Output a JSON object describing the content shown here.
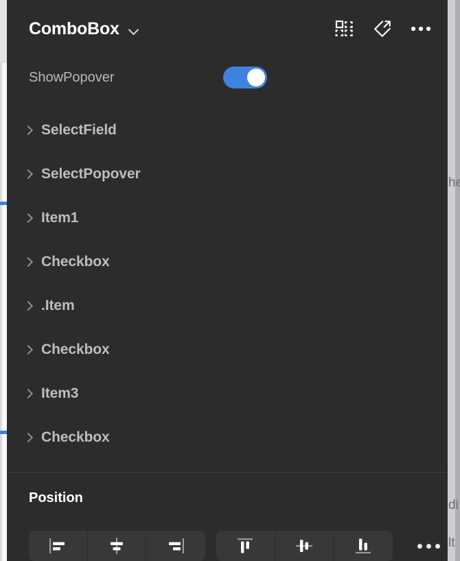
{
  "colors": {
    "panel_bg": "#2c2c2c",
    "canvas_bg": "#c9c9cd",
    "accent_blue": "#3f82e0",
    "group_bg": "#383838",
    "text_primary": "#ffffff",
    "text_secondary": "#bdbdbd"
  },
  "header": {
    "title": "ComboBox",
    "dropdown_icon": "chevron-down-icon",
    "actions": [
      {
        "name": "component-grid-icon",
        "label": "Components"
      },
      {
        "name": "detach-instance-icon",
        "label": "Detach instance"
      },
      {
        "name": "more-options-icon",
        "label": "More options"
      }
    ]
  },
  "properties": [
    {
      "label": "ShowPopover",
      "type": "toggle",
      "value": "on"
    }
  ],
  "tree": {
    "items": [
      {
        "label": "SelectField",
        "expanded": false
      },
      {
        "label": "SelectPopover",
        "expanded": false
      },
      {
        "label": "Item1",
        "expanded": false
      },
      {
        "label": "Checkbox",
        "expanded": false
      },
      {
        "label": ".Item",
        "expanded": false
      },
      {
        "label": "Checkbox",
        "expanded": false
      },
      {
        "label": "Item3",
        "expanded": false
      },
      {
        "label": "Checkbox",
        "expanded": false
      }
    ]
  },
  "position": {
    "title": "Position",
    "horizontal_align": [
      {
        "name": "align-left-icon",
        "label": "Align left"
      },
      {
        "name": "align-horizontal-center-icon",
        "label": "Align horizontal centers"
      },
      {
        "name": "align-right-icon",
        "label": "Align right"
      }
    ],
    "vertical_align": [
      {
        "name": "align-top-icon",
        "label": "Align top"
      },
      {
        "name": "align-vertical-center-icon",
        "label": "Align vertical centers"
      },
      {
        "name": "align-bottom-icon",
        "label": "Align bottom"
      }
    ],
    "more_label": "More align options"
  },
  "canvas": {
    "clipped_text": [
      "he",
      "di",
      "lt"
    ]
  }
}
